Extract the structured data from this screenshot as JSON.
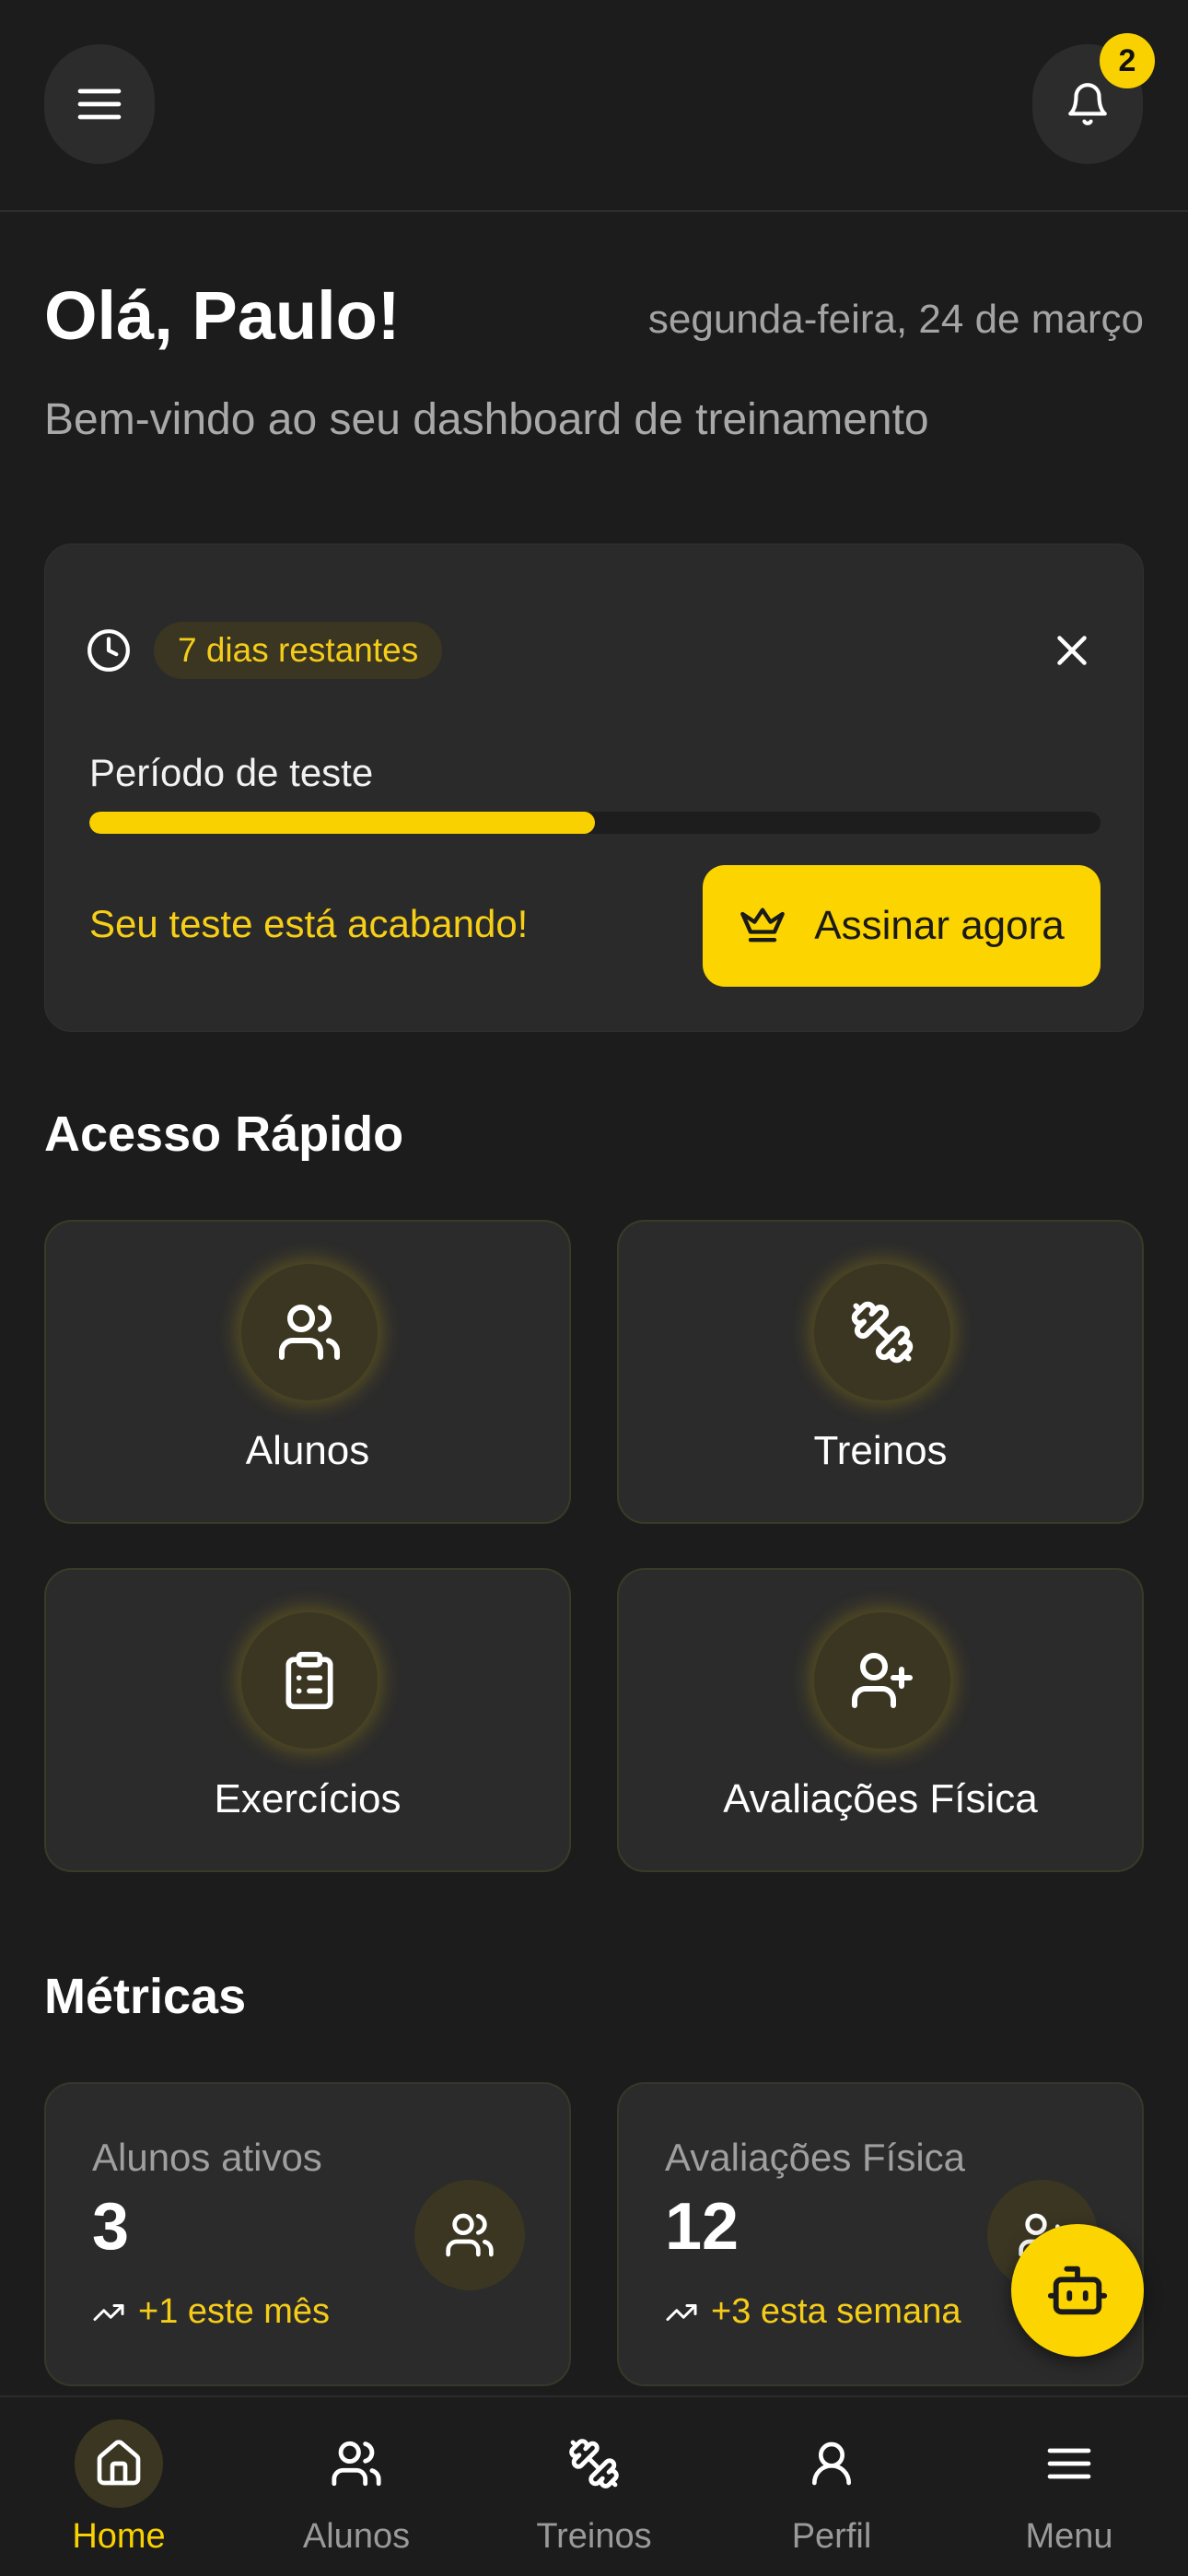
{
  "header": {
    "notification_count": "2"
  },
  "greeting": {
    "title": "Olá, Paulo!",
    "date": "segunda-feira, 24 de março",
    "subtitle": "Bem-vindo ao seu dashboard de treinamento"
  },
  "trial": {
    "days_left": "7 dias restantes",
    "period_label": "Período de teste",
    "progress_fraction": 0.5,
    "warning": "Seu teste está acabando!",
    "subscribe_label": "Assinar agora"
  },
  "quick_access": {
    "title": "Acesso Rápido",
    "items": [
      {
        "label": "Alunos",
        "icon": "users-icon"
      },
      {
        "label": "Treinos",
        "icon": "dumbbell-icon"
      },
      {
        "label": "Exercícios",
        "icon": "clipboard-list-icon"
      },
      {
        "label": "Avaliações Física",
        "icon": "user-plus-icon"
      }
    ]
  },
  "metrics": {
    "title": "Métricas",
    "cards": [
      {
        "label": "Alunos ativos",
        "value": "3",
        "trend": "+1 este mês",
        "icon": "users-icon"
      },
      {
        "label": "Avaliações Física",
        "value": "12",
        "trend": "+3 esta semana",
        "icon": "user-plus-icon"
      }
    ]
  },
  "nav": {
    "items": [
      {
        "label": "Home",
        "icon": "home-icon",
        "active": true
      },
      {
        "label": "Alunos",
        "icon": "users-icon"
      },
      {
        "label": "Treinos",
        "icon": "dumbbell-icon"
      },
      {
        "label": "Perfil",
        "icon": "user-icon"
      },
      {
        "label": "Menu",
        "icon": "menu-icon"
      }
    ]
  },
  "colors": {
    "background": "#1c1c1c",
    "card": "#2a2a2a",
    "accent": "#f9d100",
    "muted_text": "#a4a4a4"
  }
}
